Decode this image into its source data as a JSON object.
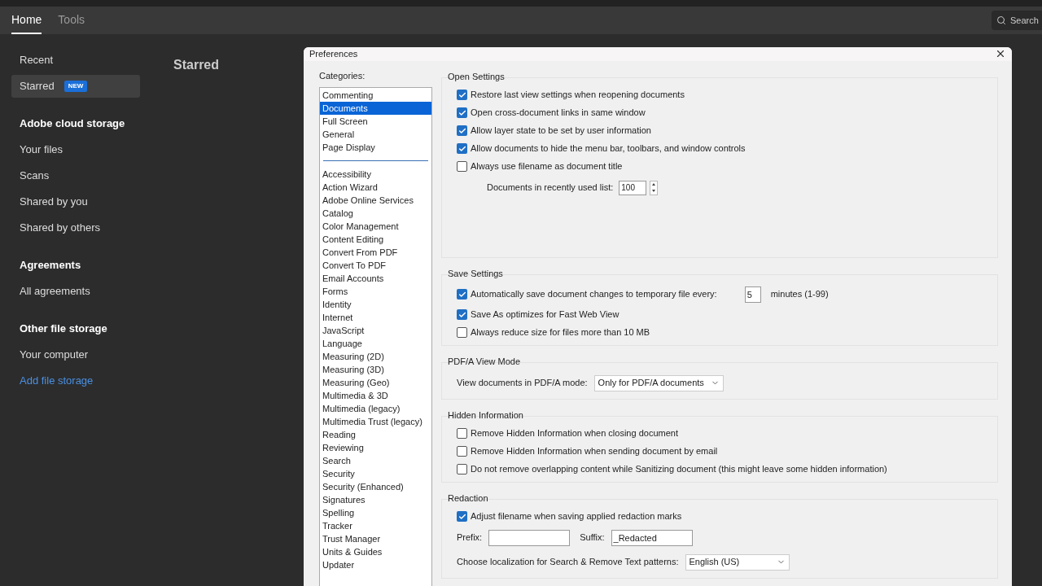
{
  "tabs": [
    {
      "label": "Home",
      "selected": true
    },
    {
      "label": "Tools",
      "selected": false
    }
  ],
  "search": {
    "placeholder": "Search"
  },
  "sidebar": [
    {
      "kind": "item",
      "label": "Recent",
      "selected": false
    },
    {
      "kind": "item",
      "label": "Starred",
      "selected": true,
      "badge": "NEW"
    },
    {
      "kind": "heading",
      "label": "Adobe cloud storage"
    },
    {
      "kind": "item",
      "label": "Your files",
      "selected": false
    },
    {
      "kind": "item",
      "label": "Scans",
      "selected": false
    },
    {
      "kind": "item",
      "label": "Shared by you",
      "selected": false
    },
    {
      "kind": "item",
      "label": "Shared by others",
      "selected": false
    },
    {
      "kind": "heading",
      "label": "Agreements"
    },
    {
      "kind": "item",
      "label": "All agreements",
      "selected": false
    },
    {
      "kind": "heading",
      "label": "Other file storage"
    },
    {
      "kind": "item",
      "label": "Your computer",
      "selected": false
    },
    {
      "kind": "link",
      "label": "Add file storage"
    }
  ],
  "content_title": "Starred",
  "dialog": {
    "title": "Preferences",
    "categories_label": "Categories:",
    "category_groups": [
      [
        {
          "label": "Commenting",
          "selected": false
        },
        {
          "label": "Documents",
          "selected": true
        },
        {
          "label": "Full Screen",
          "selected": false
        },
        {
          "label": "General",
          "selected": false
        },
        {
          "label": "Page Display",
          "selected": false
        }
      ],
      [
        {
          "label": "Accessibility",
          "selected": false
        },
        {
          "label": "Action Wizard",
          "selected": false
        },
        {
          "label": "Adobe Online Services",
          "selected": false
        },
        {
          "label": "Catalog",
          "selected": false
        },
        {
          "label": "Color Management",
          "selected": false
        },
        {
          "label": "Content Editing",
          "selected": false
        },
        {
          "label": "Convert From PDF",
          "selected": false
        },
        {
          "label": "Convert To PDF",
          "selected": false
        },
        {
          "label": "Email Accounts",
          "selected": false
        },
        {
          "label": "Forms",
          "selected": false
        },
        {
          "label": "Identity",
          "selected": false
        },
        {
          "label": "Internet",
          "selected": false
        },
        {
          "label": "JavaScript",
          "selected": false
        },
        {
          "label": "Language",
          "selected": false
        },
        {
          "label": "Measuring (2D)",
          "selected": false
        },
        {
          "label": "Measuring (3D)",
          "selected": false
        },
        {
          "label": "Measuring (Geo)",
          "selected": false
        },
        {
          "label": "Multimedia & 3D",
          "selected": false
        },
        {
          "label": "Multimedia (legacy)",
          "selected": false
        },
        {
          "label": "Multimedia Trust (legacy)",
          "selected": false
        },
        {
          "label": "Reading",
          "selected": false
        },
        {
          "label": "Reviewing",
          "selected": false
        },
        {
          "label": "Search",
          "selected": false
        },
        {
          "label": "Security",
          "selected": false
        },
        {
          "label": "Security (Enhanced)",
          "selected": false
        },
        {
          "label": "Signatures",
          "selected": false
        },
        {
          "label": "Spelling",
          "selected": false
        },
        {
          "label": "Tracker",
          "selected": false
        },
        {
          "label": "Trust Manager",
          "selected": false
        },
        {
          "label": "Units & Guides",
          "selected": false
        },
        {
          "label": "Updater",
          "selected": false
        }
      ]
    ],
    "sections": [
      {
        "title": "Open Settings",
        "rows": [
          {
            "kind": "checkbox",
            "label": "Restore last view settings when reopening documents",
            "checked": true
          },
          {
            "kind": "checkbox",
            "label": "Open cross-document links in same window",
            "checked": true
          },
          {
            "kind": "checkbox",
            "label": "Allow layer state to be set by user information",
            "checked": true
          },
          {
            "kind": "checkbox",
            "label": "Allow documents to hide the menu bar, toolbars, and window controls",
            "checked": true
          },
          {
            "kind": "checkbox",
            "label": "Always use filename as document title",
            "checked": false
          },
          {
            "kind": "spinner",
            "label": "Documents in recently used list:",
            "value": "100"
          }
        ]
      },
      {
        "title": "Save Settings",
        "rows": [
          {
            "kind": "checkbox_number",
            "label": "Automatically save document changes to temporary file every:",
            "checked": true,
            "value": "5",
            "unit": "minutes (1-99)"
          },
          {
            "kind": "checkbox",
            "label": "Save As optimizes for Fast Web View",
            "checked": true
          },
          {
            "kind": "checkbox",
            "label": "Always reduce size for files more than 10 MB",
            "checked": false
          }
        ]
      },
      {
        "title": "PDF/A View Mode",
        "rows": [
          {
            "kind": "select",
            "label": "View documents in PDF/A mode:",
            "value": "Only for PDF/A documents"
          }
        ]
      },
      {
        "title": "Hidden Information",
        "rows": [
          {
            "kind": "checkbox",
            "label": "Remove Hidden Information when closing document",
            "checked": false
          },
          {
            "kind": "checkbox",
            "label": "Remove Hidden Information when sending document by email",
            "checked": false
          },
          {
            "kind": "checkbox",
            "label": "Do not remove overlapping content while Sanitizing document (this might leave some hidden information)",
            "checked": false
          }
        ]
      },
      {
        "title": "Redaction",
        "rows": [
          {
            "kind": "checkbox",
            "label": "Adjust filename when saving applied redaction marks",
            "checked": true
          },
          {
            "kind": "prefix_suffix",
            "prefix_label": "Prefix:",
            "suffix_label": "Suffix:",
            "suffix_value": "_Redacted"
          },
          {
            "kind": "select",
            "label": "Choose localization for Search & Remove Text patterns:",
            "value": "English (US)"
          }
        ]
      }
    ]
  }
}
